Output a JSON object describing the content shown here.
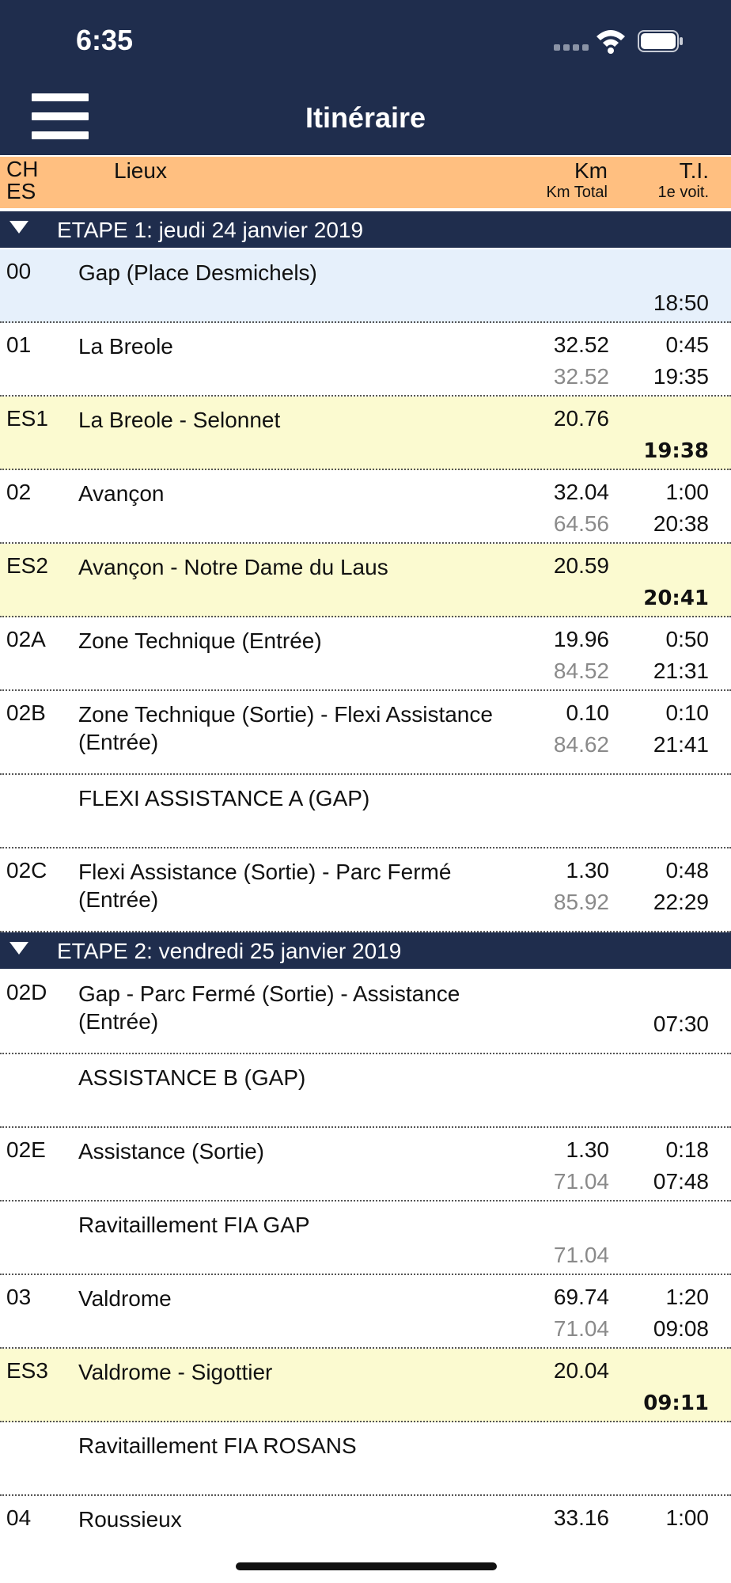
{
  "status": {
    "time": "6:35"
  },
  "nav": {
    "title": "Itinéraire"
  },
  "columns": {
    "ch_line1": "CH",
    "ch_line2": "ES",
    "lieux": "Lieux",
    "km": "Km",
    "km_total": "Km Total",
    "ti": "T.I.",
    "ti_sub": "1e voit."
  },
  "stages": [
    {
      "label": "ETAPE 1: jeudi 24 janvier 2019"
    },
    {
      "label": "ETAPE 2: vendredi 25 janvier 2019"
    }
  ],
  "rows": [
    {
      "code": "00",
      "place": "Gap (Place Desmichels)",
      "km": "",
      "km_total": "",
      "ti": "",
      "time": "18:50"
    },
    {
      "code": "01",
      "place": "La Breole",
      "km": "32.52",
      "km_total": "32.52",
      "ti": "0:45",
      "time": "19:35"
    },
    {
      "code": "ES1",
      "place": "La Breole - Selonnet",
      "km": "20.76",
      "km_total": "",
      "ti": "",
      "time": "19:38"
    },
    {
      "code": "02",
      "place": "Avançon",
      "km": "32.04",
      "km_total": "64.56",
      "ti": "1:00",
      "time": "20:38"
    },
    {
      "code": "ES2",
      "place": "Avançon - Notre Dame du Laus",
      "km": "20.59",
      "km_total": "",
      "ti": "",
      "time": "20:41"
    },
    {
      "code": "02A",
      "place": "Zone Technique (Entrée)",
      "km": "19.96",
      "km_total": "84.52",
      "ti": "0:50",
      "time": "21:31"
    },
    {
      "code": "02B",
      "place": "Zone Technique (Sortie) - Flexi Assistance (Entrée)",
      "km": "0.10",
      "km_total": "84.62",
      "ti": "0:10",
      "time": "21:41"
    },
    {
      "code": "",
      "place": "FLEXI ASSISTANCE A (GAP)",
      "km": "",
      "km_total": "",
      "ti": "",
      "time": ""
    },
    {
      "code": "02C",
      "place": "Flexi Assistance (Sortie) - Parc Fermé (Entrée)",
      "km": "1.30",
      "km_total": "85.92",
      "ti": "0:48",
      "time": "22:29"
    },
    {
      "code": "02D",
      "place": "Gap - Parc Fermé (Sortie) - Assistance (Entrée)",
      "km": "",
      "km_total": "",
      "ti": "",
      "time": "07:30"
    },
    {
      "code": "",
      "place": "ASSISTANCE B (GAP)",
      "km": "",
      "km_total": "",
      "ti": "",
      "time": ""
    },
    {
      "code": "02E",
      "place": "Assistance (Sortie)",
      "km": "1.30",
      "km_total": "71.04",
      "ti": "0:18",
      "time": "07:48"
    },
    {
      "code": "",
      "place": "Ravitaillement FIA GAP",
      "km": "",
      "km_total": "71.04",
      "ti": "",
      "time": ""
    },
    {
      "code": "03",
      "place": "Valdrome",
      "km": "69.74",
      "km_total": "71.04",
      "ti": "1:20",
      "time": "09:08"
    },
    {
      "code": "ES3",
      "place": "Valdrome - Sigottier",
      "km": "20.04",
      "km_total": "",
      "ti": "",
      "time": "09:11"
    },
    {
      "code": "",
      "place": "Ravitaillement FIA ROSANS",
      "km": "",
      "km_total": "",
      "ti": "",
      "time": ""
    },
    {
      "code": "04",
      "place": "Roussieux",
      "km": "33.16",
      "km_total": "",
      "ti": "1:00",
      "time": ""
    }
  ],
  "colors": {
    "navbar": "#1f2d4d",
    "header": "#ffbf80",
    "special_stage": "#fbfad0",
    "start_row": "#e6f0fb"
  },
  "icons": [
    "menu-icon",
    "wifi-icon",
    "battery-icon",
    "signal-icon",
    "collapse-triangle-icon"
  ]
}
